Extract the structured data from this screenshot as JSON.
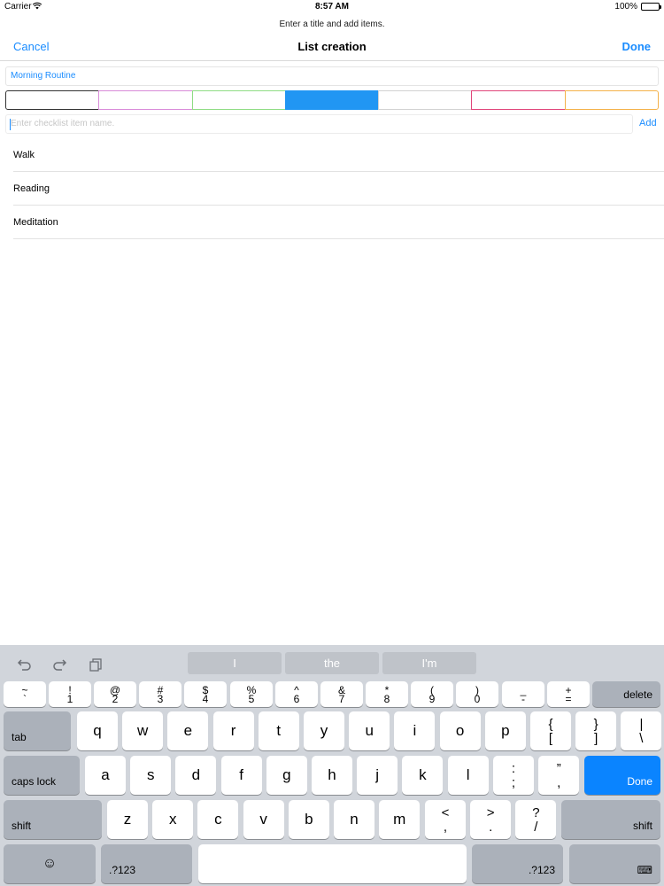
{
  "status": {
    "carrier": "Carrier",
    "time": "8:57 AM",
    "battery": "100%",
    "battery_level": 1.0
  },
  "nav": {
    "prompt": "Enter a title and add items.",
    "cancel": "Cancel",
    "title": "List creation",
    "done": "Done"
  },
  "form": {
    "title_value": "Morning Routine",
    "colors": [
      {
        "border": "#333333",
        "fill": "#ffffff",
        "selected": false
      },
      {
        "border": "#d98bd9",
        "fill": "#ffffff",
        "selected": false
      },
      {
        "border": "#8fdc84",
        "fill": "#ffffff",
        "selected": false
      },
      {
        "border": "#2196f3",
        "fill": "#2196f3",
        "selected": true
      },
      {
        "border": "#d2d2d2",
        "fill": "#ffffff",
        "selected": false
      },
      {
        "border": "#e0467a",
        "fill": "#ffffff",
        "selected": false
      },
      {
        "border": "#f4b24a",
        "fill": "#ffffff",
        "selected": false
      }
    ],
    "item_placeholder": "Enter checklist item name.",
    "add_label": "Add"
  },
  "items": [
    {
      "label": "Walk"
    },
    {
      "label": "Reading"
    },
    {
      "label": "Meditation"
    }
  ],
  "keyboard": {
    "suggestions": [
      "I",
      "the",
      "I'm"
    ],
    "toolbar_icons": [
      "undo-icon",
      "redo-icon",
      "paste-icon"
    ],
    "number_row": [
      {
        "top": "~",
        "bottom": "`"
      },
      {
        "top": "!",
        "bottom": "1"
      },
      {
        "top": "@",
        "bottom": "2"
      },
      {
        "top": "#",
        "bottom": "3"
      },
      {
        "top": "$",
        "bottom": "4"
      },
      {
        "top": "%",
        "bottom": "5"
      },
      {
        "top": "^",
        "bottom": "6"
      },
      {
        "top": "&",
        "bottom": "7"
      },
      {
        "top": "*",
        "bottom": "8"
      },
      {
        "top": "(",
        "bottom": "9"
      },
      {
        "top": ")",
        "bottom": "0"
      },
      {
        "top": "_",
        "bottom": "-"
      },
      {
        "top": "+",
        "bottom": "="
      }
    ],
    "delete_label": "delete",
    "tab_label": "tab",
    "row_q": [
      "q",
      "w",
      "e",
      "r",
      "t",
      "y",
      "u",
      "i",
      "o",
      "p"
    ],
    "row_q_symbols": [
      {
        "top": "{",
        "bottom": "["
      },
      {
        "top": "}",
        "bottom": "]"
      },
      {
        "top": "|",
        "bottom": "\\"
      }
    ],
    "caps_label": "caps lock",
    "row_a": [
      "a",
      "s",
      "d",
      "f",
      "g",
      "h",
      "j",
      "k",
      "l"
    ],
    "row_a_symbols": [
      {
        "top": ":",
        "bottom": ";"
      },
      {
        "top": "”",
        "bottom": ","
      }
    ],
    "return_label": "Done",
    "shift_label": "shift",
    "row_z": [
      "z",
      "x",
      "c",
      "v",
      "b",
      "n",
      "m"
    ],
    "row_z_symbols": [
      {
        "top": "<",
        "bottom": ","
      },
      {
        "top": ">",
        "bottom": "."
      },
      {
        "top": "?",
        "bottom": "/"
      }
    ],
    "numbers_label": ".?123",
    "emoji_glyph": "☺",
    "hide_glyph": "⌨"
  }
}
